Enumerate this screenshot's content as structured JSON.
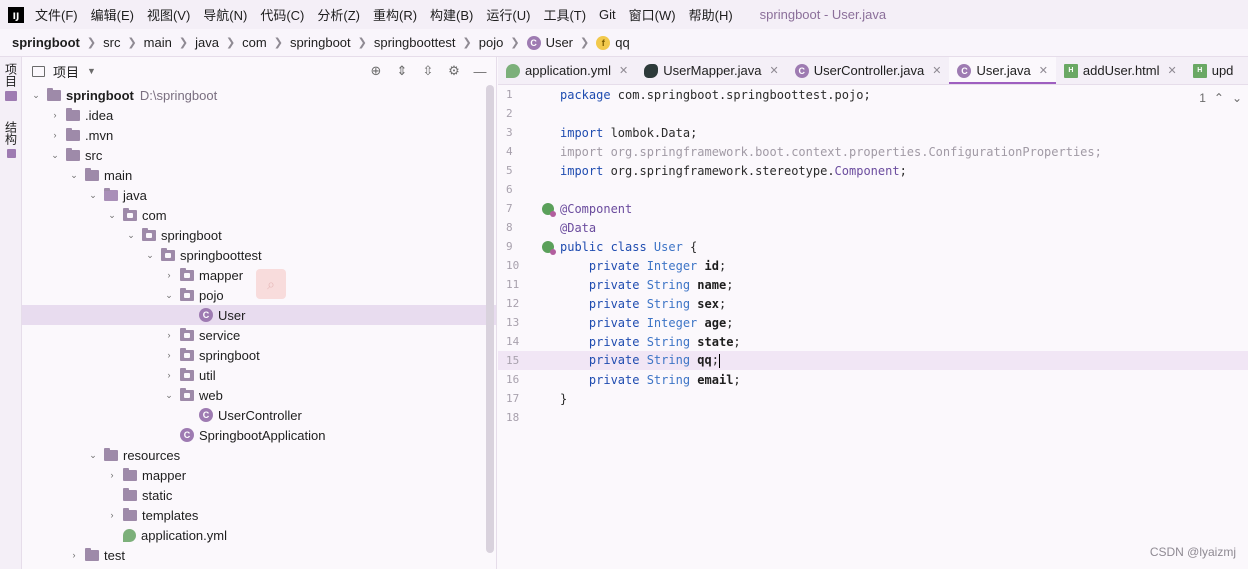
{
  "menubar": {
    "items": [
      "文件(F)",
      "编辑(E)",
      "视图(V)",
      "导航(N)",
      "代码(C)",
      "分析(Z)",
      "重构(R)",
      "构建(B)",
      "运行(U)",
      "工具(T)",
      "Git",
      "窗口(W)",
      "帮助(H)"
    ],
    "window_title": "springboot - User.java"
  },
  "breadcrumb": [
    "springboot",
    "src",
    "main",
    "java",
    "com",
    "springboot",
    "springboottest",
    "pojo",
    "User",
    "qq"
  ],
  "toolstrip": {
    "project": "项目",
    "structure": "结构"
  },
  "project_panel": {
    "title": "项目",
    "rows": [
      {
        "label": "springboot",
        "path": "D:\\springboot"
      },
      {
        "label": ".idea"
      },
      {
        "label": ".mvn"
      },
      {
        "label": "src"
      },
      {
        "label": "main"
      },
      {
        "label": "java"
      },
      {
        "label": "com"
      },
      {
        "label": "springboot"
      },
      {
        "label": "springboottest"
      },
      {
        "label": "mapper"
      },
      {
        "label": "pojo"
      },
      {
        "label": "User"
      },
      {
        "label": "service"
      },
      {
        "label": "springboot"
      },
      {
        "label": "util"
      },
      {
        "label": "web"
      },
      {
        "label": "UserController"
      },
      {
        "label": "SpringbootApplication"
      },
      {
        "label": "resources"
      },
      {
        "label": "mapper"
      },
      {
        "label": "static"
      },
      {
        "label": "templates"
      },
      {
        "label": "application.yml"
      },
      {
        "label": "test"
      }
    ]
  },
  "editor": {
    "tabs": [
      {
        "label": "application.yml",
        "icon": "yml-icon"
      },
      {
        "label": "UserMapper.java",
        "icon": "mybatis-icon"
      },
      {
        "label": "UserController.java",
        "icon": "class-icon"
      },
      {
        "label": "User.java",
        "icon": "class-icon",
        "active": true
      },
      {
        "label": "addUser.html",
        "icon": "html-icon"
      },
      {
        "label": "upd",
        "icon": "html-icon"
      }
    ],
    "inspection_count": "1",
    "line_numbers": [
      "1",
      "2",
      "3",
      "4",
      "5",
      "6",
      "7",
      "8",
      "9",
      "10",
      "11",
      "12",
      "13",
      "14",
      "15",
      "16",
      "17",
      "18"
    ],
    "current_line": 15,
    "code": {
      "l1_kw": "package ",
      "l1_pkg": "com.springboot.springboottest.pojo",
      "l1_end": ";",
      "l3_kw": "import ",
      "l3_pkg": "lombok.",
      "l3_cls": "Data",
      "l3_end": ";",
      "l4": "import org.springframework.boot.context.properties.ConfigurationProperties;",
      "l5_kw": "import ",
      "l5_pkg": "org.springframework.stereotype.",
      "l5_cls": "Component",
      "l5_end": ";",
      "l7": "@Component",
      "l8": "@Data",
      "l9_kw": "public class ",
      "l9_cls": "User",
      "l9_end": " {",
      "fields": [
        {
          "mod": "    private ",
          "type": "Integer",
          "name": "id"
        },
        {
          "mod": "    private ",
          "type": "String",
          "name": "name"
        },
        {
          "mod": "    private ",
          "type": "String",
          "name": "sex"
        },
        {
          "mod": "    private ",
          "type": "Integer",
          "name": "age"
        },
        {
          "mod": "    private ",
          "type": "String",
          "name": "state"
        },
        {
          "mod": "    private ",
          "type": "String",
          "name": "qq"
        },
        {
          "mod": "    private ",
          "type": "String",
          "name": "email"
        }
      ],
      "semicolon": ";",
      "close": "}"
    }
  },
  "watermark": "CSDN @lyaizmj"
}
